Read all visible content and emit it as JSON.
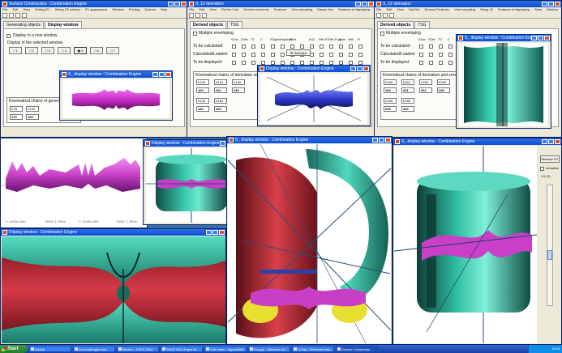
{
  "app": {
    "accent": "#0b4fd6",
    "teal": "#2fc0a4",
    "magenta": "#d43fd0",
    "red": "#c8303a",
    "blue": "#2838c8"
  },
  "win1": {
    "title": "Surface Construction : Combination Engine",
    "menu": [
      "File",
      "Edit",
      "View",
      "Setting E1",
      "Seting E2 window",
      "E1 appearance",
      "Window",
      "Printing",
      "Options",
      "Help"
    ],
    "tabs": [
      "Generating objects",
      "Display window"
    ],
    "display_new": "Display in a new window",
    "display_selected": "Display in the selected window",
    "btns": [
      "1",
      "2",
      "3",
      "4",
      "5",
      "6",
      "7"
    ],
    "chain_label": "Kinematical chains of generating surfaces",
    "fields": [
      "K78",
      "K100",
      "170",
      "100"
    ]
  },
  "win2": {
    "title": "S_13 derivation",
    "menu": [
      "File",
      "Edit",
      "View",
      "Rot lim Calc",
      "Derived elements",
      "Features",
      "View sampling",
      "Sampl. line",
      "Features of displaying",
      "Save",
      "Window",
      "Help"
    ],
    "tabs": [
      "Derived objects",
      "TSG"
    ],
    "multiple": "Multiple enveloping",
    "cols": [
      "S2uv",
      "S2bv",
      "T2",
      "C",
      "S2glob",
      "Sapliced",
      "S2ef",
      "",
      "rf,t2",
      "Rfrt-Fi",
      "Rfrt-Fi-qt",
      "Anim",
      "Wth",
      "R"
    ],
    "calc": "To be calculated:",
    "loaded": "Calculated/Loaded:",
    "displayed": "To be displayed:",
    "selected_btn": "Selected",
    "chain_label": "Kinematical chains of derivation and zeroline",
    "fields_row1": [
      "K100",
      "K101",
      "K130"
    ],
    "fields_row2": [
      "100",
      "101",
      "130"
    ],
    "fields_row3": [
      "K130",
      "K160"
    ],
    "fields_row4": [
      "130",
      "160"
    ]
  },
  "win3": {
    "title": "S_12 derivation",
    "menu": [
      "File",
      "Edit",
      "View",
      "Dat Rot",
      "Derived Features",
      "View sampling",
      "String 15",
      "Features of displaying",
      "Save",
      "Window",
      "Help"
    ],
    "tabs": [
      "Derived objects",
      "TSG"
    ],
    "multiple": "Multiple enveloping",
    "cols": [
      "S2uv",
      "S2bv",
      "T2",
      "C",
      "S2glob",
      "Sapliced"
    ],
    "calc": "To be calculated:",
    "loaded": "Calculated/Loaded:",
    "displayed": "To be displayed:",
    "chain_label": "Kinematical chains of derivation and zeroline plane: S_",
    "fields_row1": [
      "K100",
      "K201",
      "K202",
      "K230"
    ],
    "fields_row2": [
      "100",
      "201",
      "202",
      "230"
    ],
    "fields_row3": [
      "K230",
      "K260"
    ],
    "fields_row4": [
      "230",
      "260"
    ]
  },
  "dw1": {
    "title": "S_ display window : Combination Engine"
  },
  "dw2": {
    "title": "Display window : Combination Engine"
  },
  "dw3": {
    "title": "S_ display window : Combination Engine"
  },
  "dw4": {
    "title": "Display window : Combination Engine"
  },
  "dw5": {
    "title": "S_ display window : Combination Engine"
  },
  "dw6": {
    "title": "Display window : Combination Engine"
  },
  "dw7": {
    "title": "S_ display window : Combination Engine",
    "side_btn": "Window SC",
    "animation": "Actualise",
    "counter": "1/1 (2)"
  },
  "ticks": {
    "a": "Y: 3x10m 300",
    "b": "TM10: 1 200m",
    "c": "Y: 2x10m 300",
    "d": "TM10: 1 200m"
  },
  "taskbar": {
    "start": "Start",
    "items": [
      "Rudolf",
      "ImCombEngine.doc",
      "Meister - TNCE 2014",
      "TNCE 2014 Paper fe...",
      "Fels fellen - IngrunMeff...",
      "Google - Windows Int...",
      "UJ tap - Windows Inter...",
      "Surface Constructor"
    ],
    "clock": "10:05"
  }
}
